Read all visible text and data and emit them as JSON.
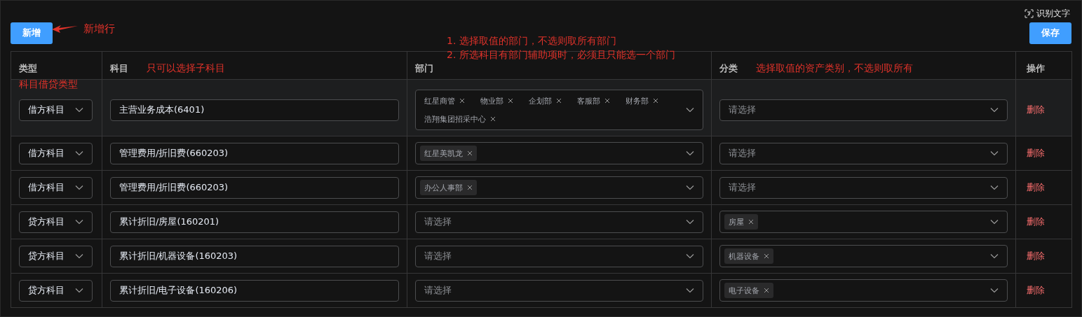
{
  "ocr_button": {
    "label": "识别文字"
  },
  "toolbar": {
    "add_button": "新增",
    "save_button": "保存"
  },
  "annotations": {
    "add_row": "新增行",
    "subject": "只可以选择子科目",
    "department": [
      "1. 选择取值的部门，不选则取所有部门",
      "2. 所选科目有部门辅助项时，必须且只能选一个部门"
    ],
    "category": "选择取值的资产类别，不选则取所有",
    "type": "科目借贷类型"
  },
  "table": {
    "columns": [
      "类型",
      "科目",
      "部门",
      "分类",
      "操作"
    ],
    "rows": [
      {
        "hovered": true,
        "type": "借方科目",
        "subject": "主营业务成本(6401)",
        "departments": [
          "红星商管",
          "物业部",
          "企划部",
          "客服部",
          "财务部",
          "浩翔集团招采中心"
        ],
        "category_placeholder": "请选择",
        "action": "删除"
      },
      {
        "hovered": false,
        "type": "借方科目",
        "subject": "管理费用/折旧费(660203)",
        "departments": [
          "红星美凯龙"
        ],
        "category_placeholder": "请选择",
        "action": "删除"
      },
      {
        "hovered": false,
        "type": "借方科目",
        "subject": "管理费用/折旧费(660203)",
        "departments": [
          "办公人事部"
        ],
        "category_placeholder": "请选择",
        "action": "删除"
      },
      {
        "hovered": false,
        "type": "贷方科目",
        "subject": "累计折旧/房屋(160201)",
        "department_placeholder": "请选择",
        "categories": [
          "房屋"
        ],
        "action": "删除"
      },
      {
        "hovered": false,
        "type": "贷方科目",
        "subject": "累计折旧/机器设备(160203)",
        "department_placeholder": "请选择",
        "categories": [
          "机器设备"
        ],
        "action": "删除"
      },
      {
        "hovered": false,
        "type": "贷方科目",
        "subject": "累计折旧/电子设备(160206)",
        "department_placeholder": "请选择",
        "categories": [
          "电子设备"
        ],
        "action": "删除"
      }
    ]
  }
}
